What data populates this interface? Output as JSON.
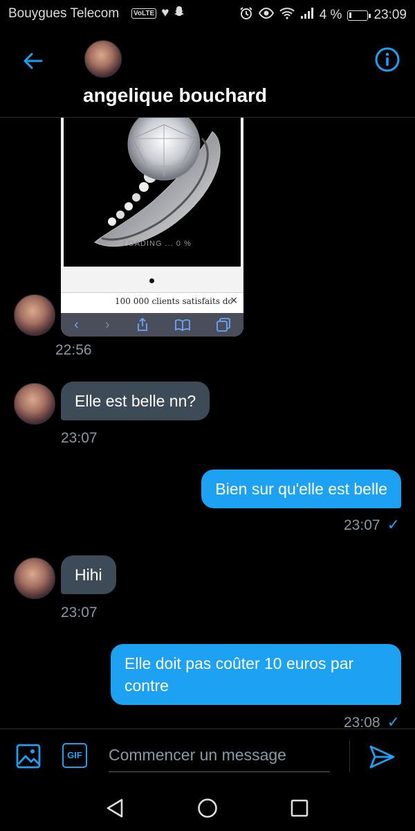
{
  "status_bar": {
    "carrier": "Bouygues Telecom",
    "volte": "VoLTE",
    "battery": "4 %",
    "time": "23:09"
  },
  "header": {
    "contact_name": "angelique bouchard"
  },
  "attachment": {
    "loading_text": "LOADING ... 0 %",
    "banner_text": "100 000 clients satisfaits dc",
    "close_glyph": "×",
    "timestamp": "22:56"
  },
  "messages": [
    {
      "direction": "in",
      "text": "Elle est belle nn?",
      "time": "23:07"
    },
    {
      "direction": "out",
      "text": "Bien sur qu'elle est belle",
      "time": "23:07",
      "read": true
    },
    {
      "direction": "in",
      "text": "Hihi",
      "time": "23:07"
    },
    {
      "direction": "out",
      "text": "Elle doit pas coûter 10 euros par contre",
      "time": "23:08",
      "read": true
    }
  ],
  "composer": {
    "placeholder": "Commencer un message",
    "gif_label": "GIF"
  },
  "colors": {
    "accent": "#1da1f2",
    "incoming_bubble": "#3d4a57",
    "background": "#000000",
    "muted_text": "#8899a6"
  },
  "icons": {
    "back": "arrow-left-icon",
    "info": "info-icon",
    "image": "image-icon",
    "gif": "gif-icon",
    "send": "send-icon",
    "read": "checkmark-icon"
  }
}
